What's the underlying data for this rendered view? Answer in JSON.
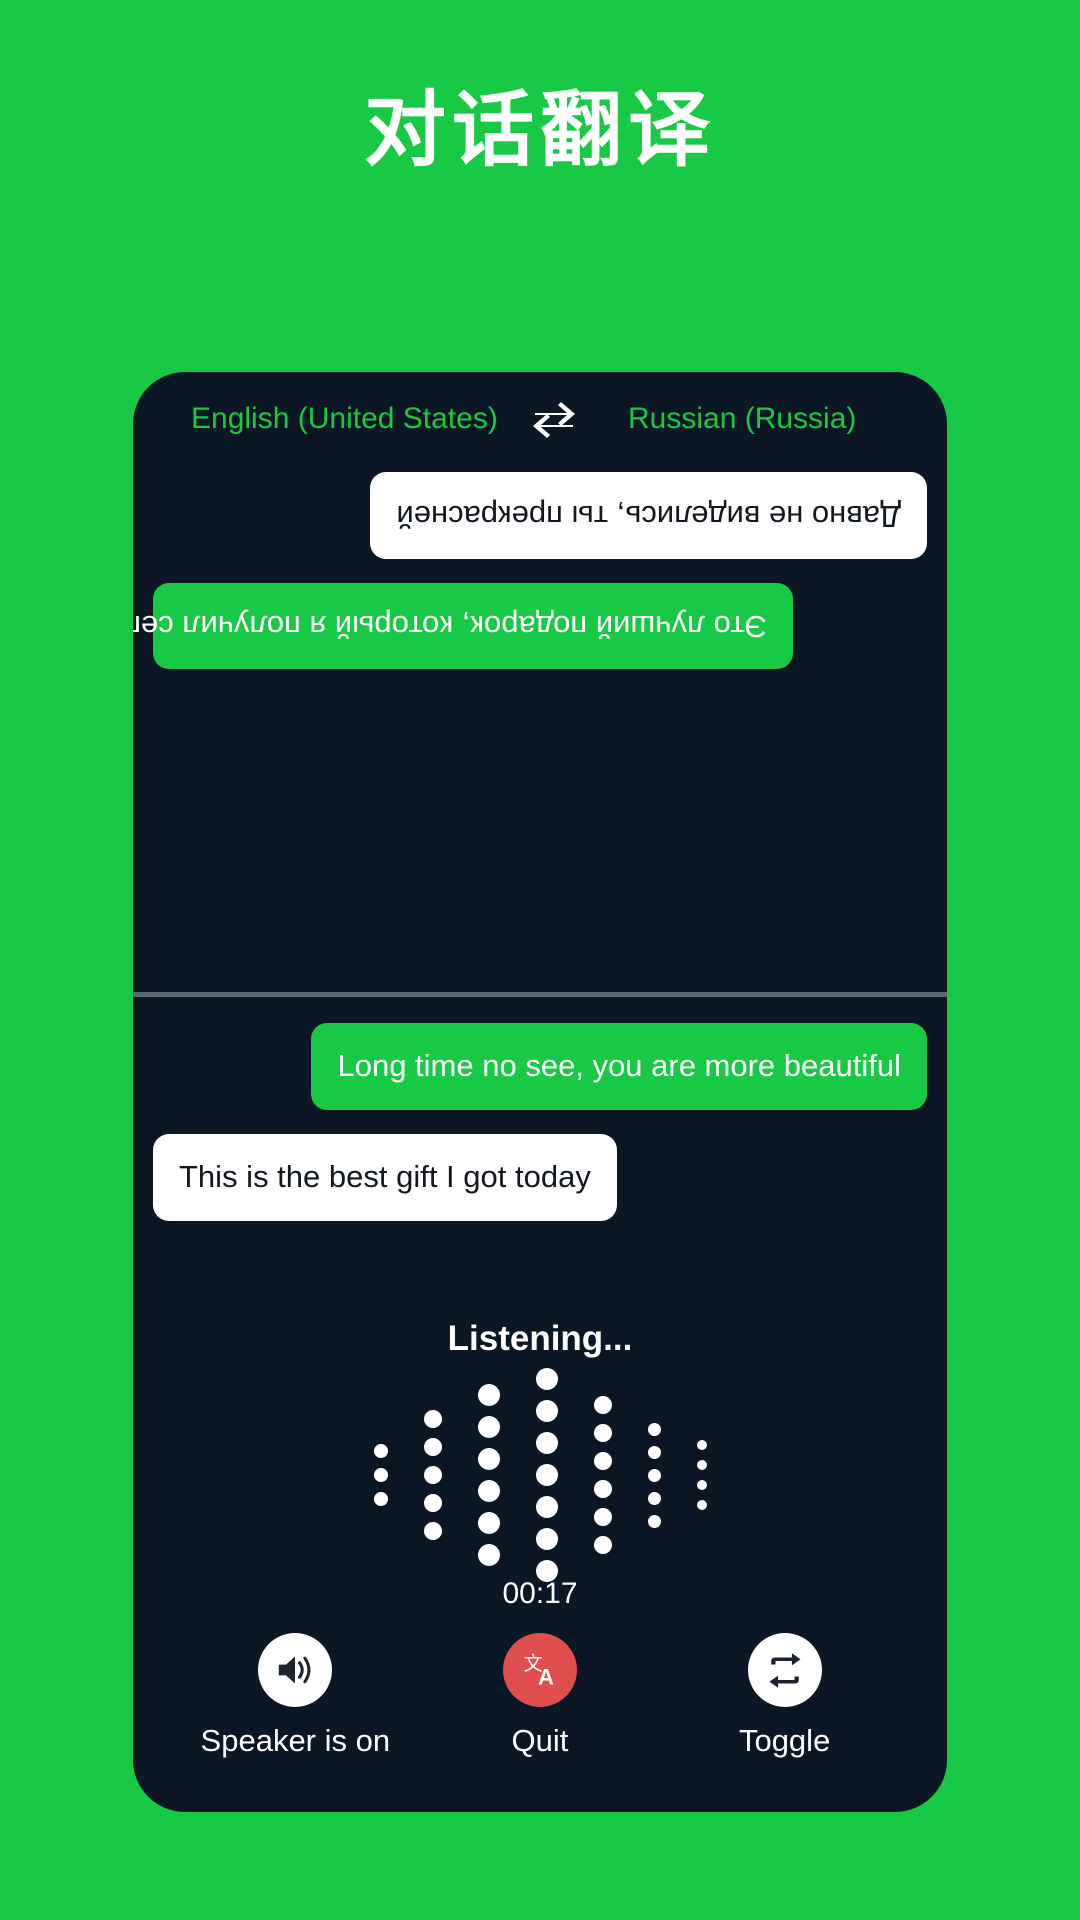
{
  "page": {
    "title": "对话翻译",
    "background_color": "#17C944",
    "panel_color": "#0B1725"
  },
  "language_bar": {
    "source_language": "English (United States)",
    "target_language": "Russian (Russia)",
    "swap_icon": "swap-horizontal-icon",
    "text_color": "#19C93F"
  },
  "conversation": {
    "top_pane_rotated": true,
    "top_messages": [
      {
        "text": "Это лучший подарок, который я получил сегодня",
        "side": "right",
        "style": "green"
      },
      {
        "text": "Давно не виделись, ты прекрасней",
        "side": "left",
        "style": "white"
      }
    ],
    "bottom_messages": [
      {
        "text": "Long time no see, you are more beautiful",
        "side": "right",
        "style": "green"
      },
      {
        "text": "This is the best gift I got today",
        "side": "left",
        "style": "white"
      }
    ]
  },
  "status": {
    "listening_label": "Listening...",
    "timer": "00:17"
  },
  "waveform": {
    "columns": [
      {
        "count": 3,
        "size": 14
      },
      {
        "count": 5,
        "size": 18
      },
      {
        "count": 6,
        "size": 22
      },
      {
        "count": 7,
        "size": 22
      },
      {
        "count": 6,
        "size": 18
      },
      {
        "count": 5,
        "size": 13
      },
      {
        "count": 4,
        "size": 10
      }
    ],
    "dot_color": "#ffffff"
  },
  "controls": [
    {
      "label": "Speaker is on",
      "icon": "speaker-on-icon",
      "circle_color": "#ffffff",
      "icon_color": "#1d242e"
    },
    {
      "label": "Quit",
      "icon": "translate-icon",
      "circle_color": "#E04F4F",
      "icon_color": "#ffffff"
    },
    {
      "label": "Toggle",
      "icon": "swap-loop-icon",
      "circle_color": "#ffffff",
      "icon_color": "#1d242e"
    }
  ]
}
